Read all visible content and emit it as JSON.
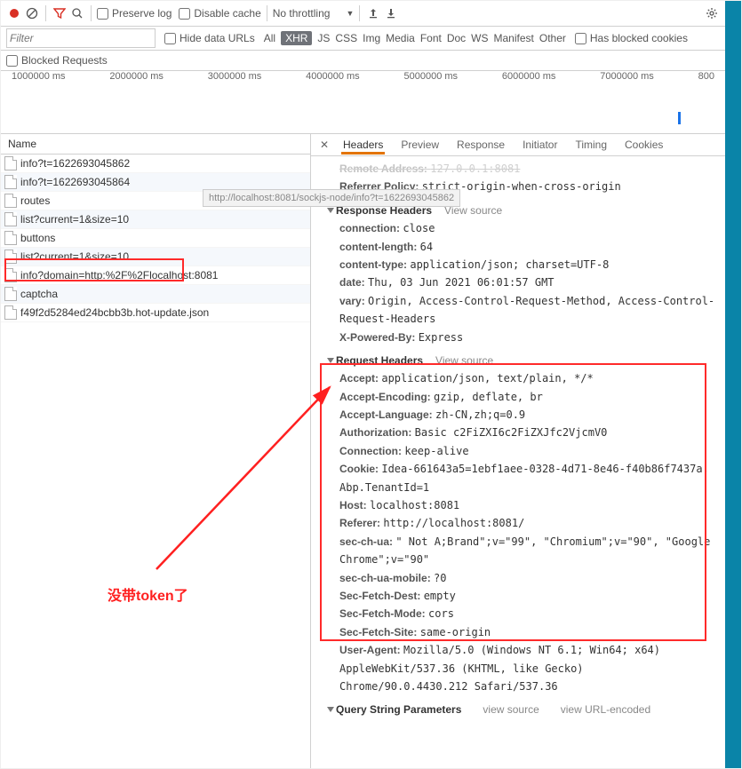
{
  "toolbar": {
    "preserve_log": "Preserve log",
    "disable_cache": "Disable cache",
    "throttling": "No throttling"
  },
  "filter_row": {
    "placeholder": "Filter",
    "hide_data_urls": "Hide data URLs",
    "types": [
      "All",
      "XHR",
      "JS",
      "CSS",
      "Img",
      "Media",
      "Font",
      "Doc",
      "WS",
      "Manifest",
      "Other"
    ],
    "active_type": "XHR",
    "has_blocked_cookies": "Has blocked cookies"
  },
  "blocked_row": {
    "label": "Blocked Requests"
  },
  "timeline_ticks": [
    "1000000 ms",
    "2000000 ms",
    "3000000 ms",
    "4000000 ms",
    "5000000 ms",
    "6000000 ms",
    "7000000 ms",
    "800"
  ],
  "name_header": "Name",
  "requests": [
    "info?t=1622693045862",
    "info?t=1622693045864",
    "routes",
    "list?current=1&size=10",
    "buttons",
    "list?current=1&size=10",
    "info?domain=http:%2F%2Flocalhost:8081",
    "captcha",
    "f49f2d5284ed24bcbb3b.hot-update.json"
  ],
  "tooltip": "http://localhost:8081/sockjs-node/info?t=1622693045862",
  "tabs": [
    "Headers",
    "Preview",
    "Response",
    "Initiator",
    "Timing",
    "Cookies"
  ],
  "active_tab": "Headers",
  "general": {
    "remote_address_label": "Remote Address:",
    "remote_address_value": "127.0.0.1:8081",
    "referrer_policy_label": "Referrer Policy:",
    "referrer_policy_value": "strict-origin-when-cross-origin"
  },
  "response_headers_title": "Response Headers",
  "request_headers_title": "Request Headers",
  "query_params_title": "Query String Parameters",
  "view_source": "View source",
  "view_source_lower": "view source",
  "view_url_encoded": "view URL-encoded",
  "response_headers": [
    {
      "k": "connection:",
      "v": "close"
    },
    {
      "k": "content-length:",
      "v": "64"
    },
    {
      "k": "content-type:",
      "v": "application/json; charset=UTF-8"
    },
    {
      "k": "date:",
      "v": "Thu, 03 Jun 2021 06:01:57 GMT"
    },
    {
      "k": "vary:",
      "v": "Origin, Access-Control-Request-Method, Access-Control-Request-Headers"
    },
    {
      "k": "X-Powered-By:",
      "v": "Express"
    }
  ],
  "request_headers": [
    {
      "k": "Accept:",
      "v": "application/json, text/plain, */*"
    },
    {
      "k": "Accept-Encoding:",
      "v": "gzip, deflate, br"
    },
    {
      "k": "Accept-Language:",
      "v": "zh-CN,zh;q=0.9"
    },
    {
      "k": "Authorization:",
      "v": "Basic c2FiZXI6c2FiZXJfc2VjcmV0"
    },
    {
      "k": "Connection:",
      "v": "keep-alive"
    },
    {
      "k": "Cookie:",
      "v": "Idea-661643a5=1ebf1aee-0328-4d71-8e46-f40b86f7437a; Abp.TenantId=1"
    },
    {
      "k": "Host:",
      "v": "localhost:8081"
    },
    {
      "k": "Referer:",
      "v": "http://localhost:8081/"
    },
    {
      "k": "sec-ch-ua:",
      "v": "\" Not A;Brand\";v=\"99\", \"Chromium\";v=\"90\", \"Google Chrome\";v=\"90\""
    },
    {
      "k": "sec-ch-ua-mobile:",
      "v": "?0"
    },
    {
      "k": "Sec-Fetch-Dest:",
      "v": "empty"
    },
    {
      "k": "Sec-Fetch-Mode:",
      "v": "cors"
    },
    {
      "k": "Sec-Fetch-Site:",
      "v": "same-origin"
    },
    {
      "k": "User-Agent:",
      "v": "Mozilla/5.0 (Windows NT 6.1; Win64; x64) AppleWebKit/537.36 (KHTML, like Gecko) Chrome/90.0.4430.212 Safari/537.36"
    }
  ],
  "annotation": "没带token了"
}
